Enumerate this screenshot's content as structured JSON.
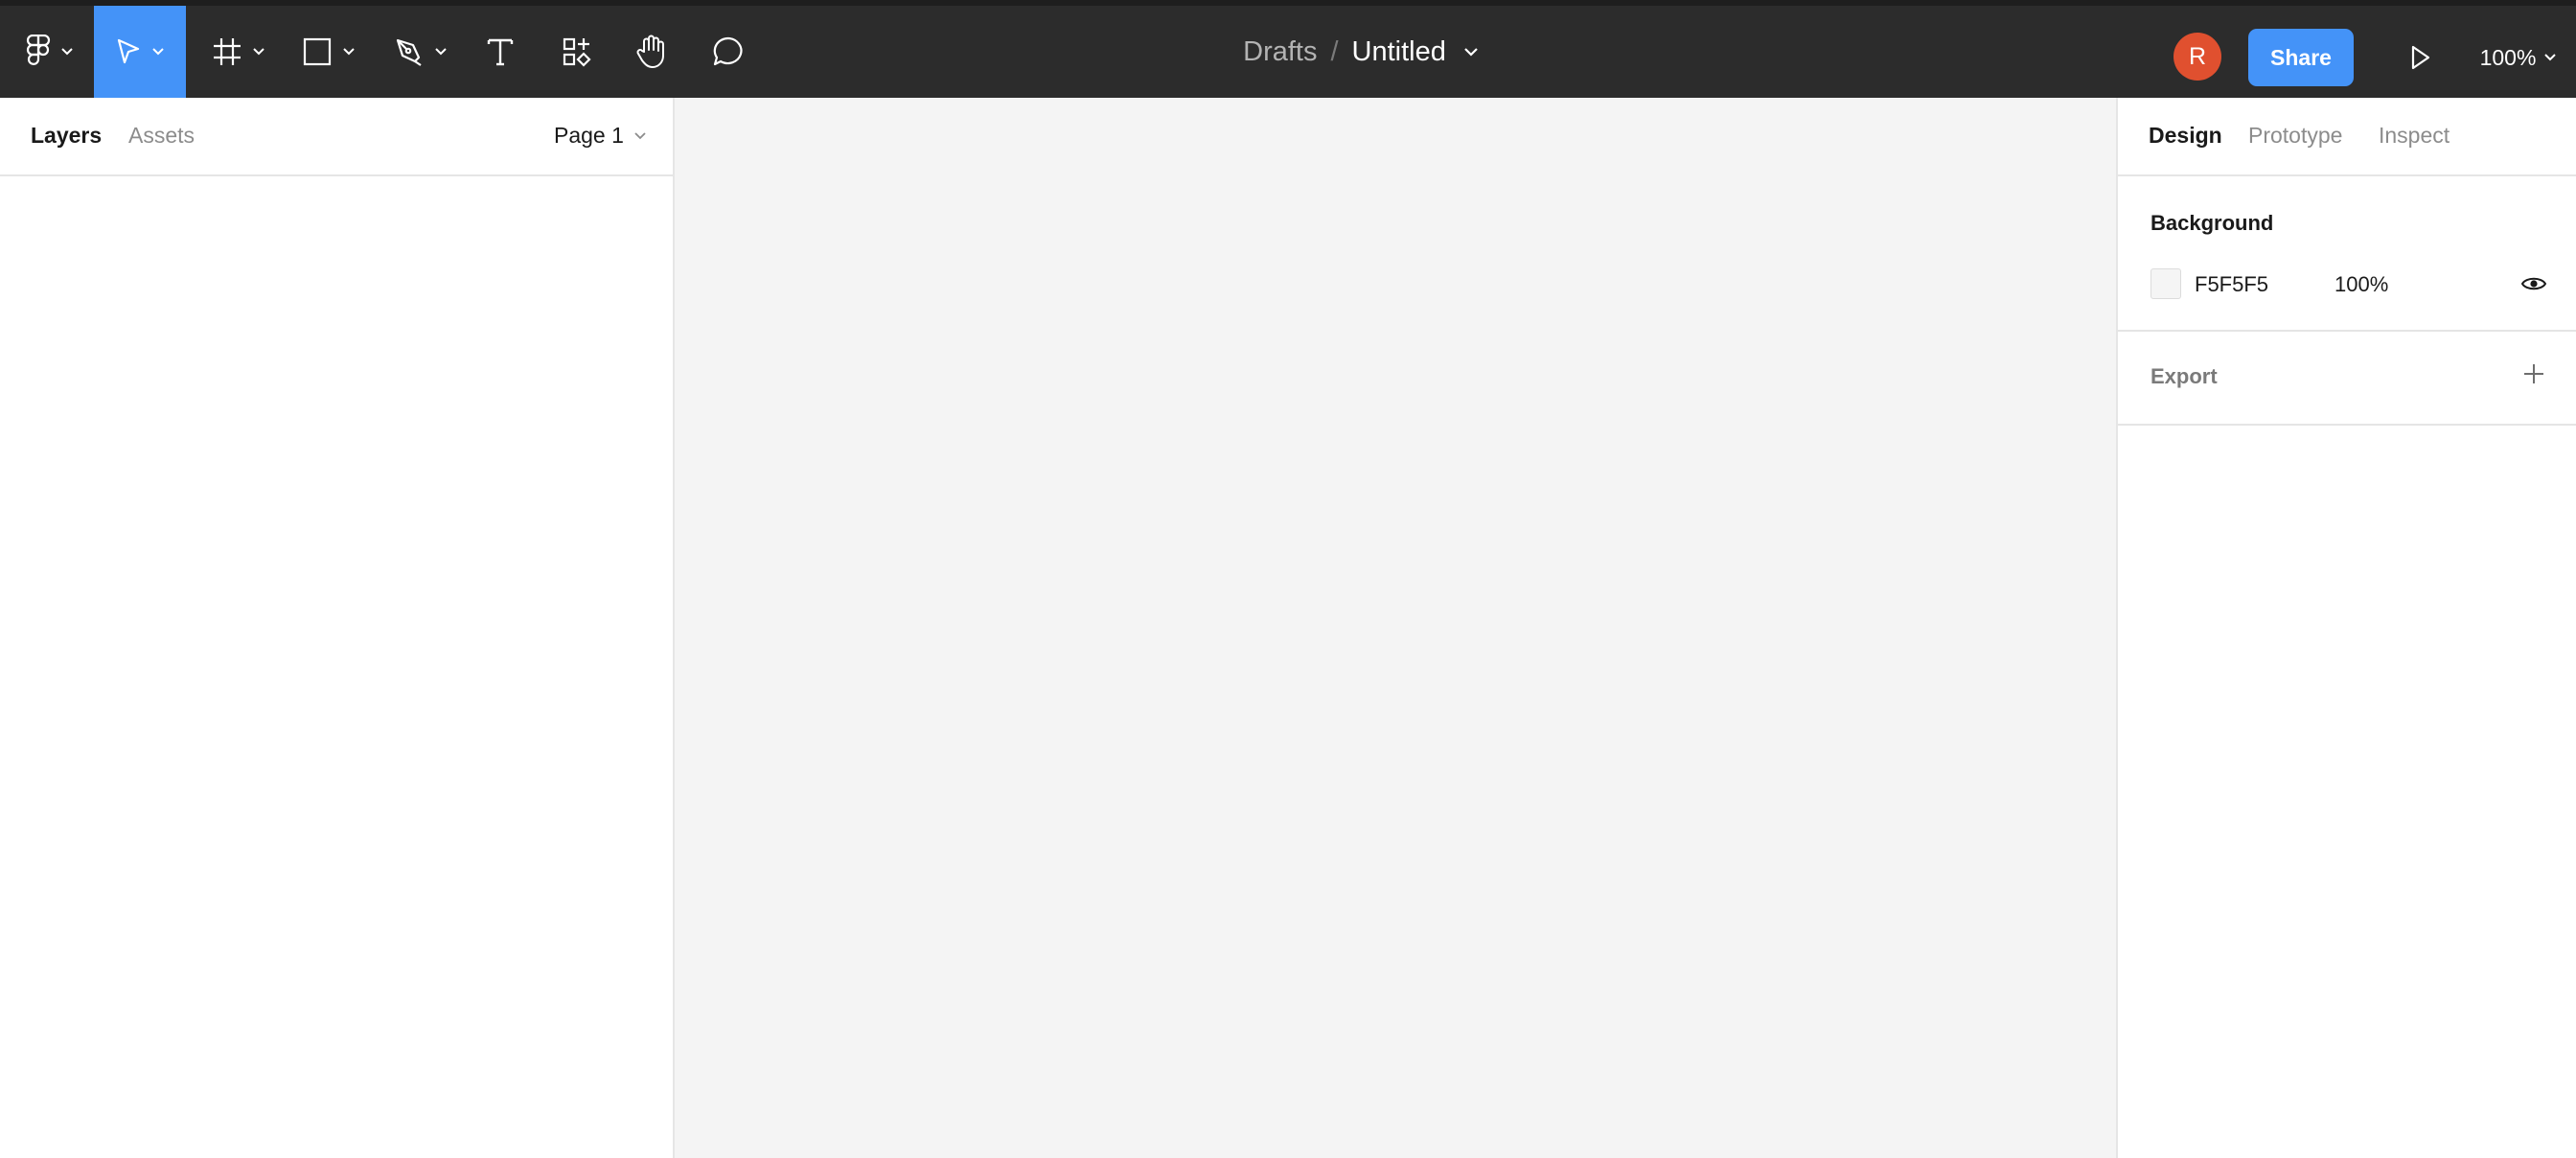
{
  "toolbar": {
    "breadcrumb": {
      "parent": "Drafts",
      "separator": "/",
      "file_title": "Untitled"
    },
    "user_initial": "R",
    "share_label": "Share",
    "zoom_level": "100%",
    "accent_color": "#4493f8",
    "tools": [
      "main-menu",
      "move",
      "frame",
      "shape",
      "pen",
      "text",
      "resources",
      "hand",
      "comment"
    ]
  },
  "left_panel": {
    "tabs": [
      "Layers",
      "Assets"
    ],
    "active_tab": "Layers",
    "page_label": "Page 1"
  },
  "right_panel": {
    "tabs": [
      "Design",
      "Prototype",
      "Inspect"
    ],
    "active_tab": "Design",
    "background": {
      "title": "Background",
      "hex": "F5F5F5",
      "opacity": "100%",
      "swatch_color": "#f5f5f5"
    },
    "export": {
      "title": "Export"
    }
  }
}
